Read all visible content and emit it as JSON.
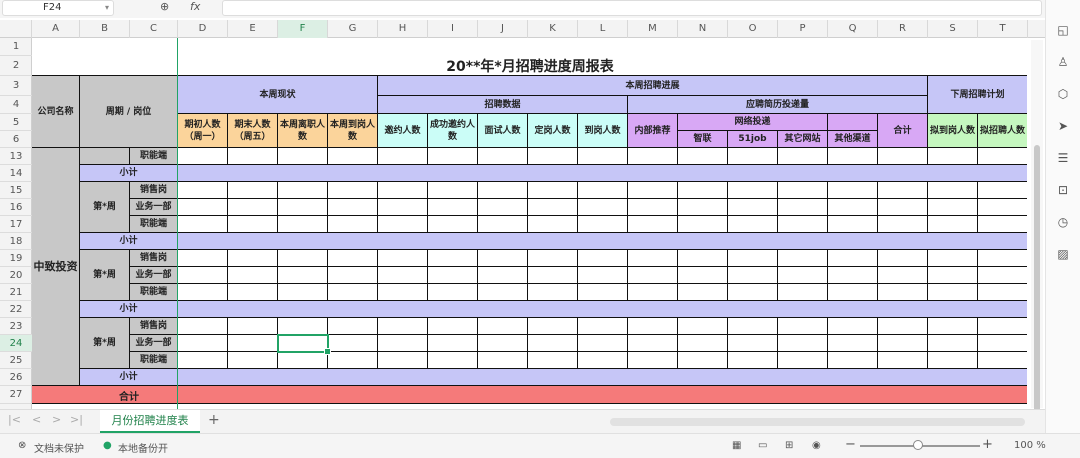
{
  "formula_bar": {
    "name_box": "F24",
    "zoom_icon": "zoom-formula-icon",
    "fx_label": "fx",
    "formula": ""
  },
  "columns": [
    "A",
    "B",
    "C",
    "D",
    "E",
    "F",
    "G",
    "H",
    "I",
    "J",
    "K",
    "L",
    "M",
    "N",
    "O",
    "P",
    "Q",
    "R",
    "S",
    "T"
  ],
  "rows": [
    "1",
    "2",
    "3",
    "4",
    "5",
    "6",
    "13",
    "14",
    "15",
    "16",
    "17",
    "18",
    "19",
    "20",
    "21",
    "22",
    "23",
    "24",
    "25",
    "26",
    "27"
  ],
  "selected": {
    "column": "F",
    "row": "24"
  },
  "sheet": {
    "title": "20**年*月招聘进度周报表",
    "company_header": "公司名称",
    "period_header": "周期 / 岗位",
    "current_status": "本周现状",
    "week_progress": "本周招聘进展",
    "next_week_plan": "下周招聘计划",
    "recruit_data": "招聘数据",
    "resume_volume": "应聘简历投递量",
    "online_delivery": "网络投递",
    "status_cols": [
      "期初人数（周一）",
      "期末人数（周五）",
      "本周离职人数",
      "本周到岗人数"
    ],
    "recruit_cols": [
      "邀约人数",
      "成功邀约人数",
      "面试人数",
      "定岗人数",
      "到岗人数"
    ],
    "internal": "内部推荐",
    "online_cols": [
      "智联",
      "51job",
      "其它网站"
    ],
    "other_channels": "其他渠道",
    "total_col": "合计",
    "plan_cols": [
      "拟到岗人数",
      "拟招聘人数"
    ],
    "company": "中致投资",
    "week_label": "第*周",
    "positions": [
      "职能端",
      "销售岗",
      "业务一部",
      "职能端"
    ],
    "subtotal": "小计",
    "grand_total": "合计"
  },
  "colors": {
    "purple": "#c6c6f7",
    "orange": "#fbd49b",
    "cyan": "#cbfdf7",
    "magenta": "#d8a8f5",
    "green": "#c5f7bf",
    "gray": "#c8c8c8",
    "red": "#f57a7a",
    "accent": "#21a366"
  },
  "tabs": {
    "prev_first": "|<",
    "prev": "<",
    "next": ">",
    "next_last": ">|",
    "active": "月份招聘进度表",
    "add": "+"
  },
  "status": {
    "protect": "文档未保护",
    "backup": "本地备份开",
    "zoom": "100 %",
    "minus": "−",
    "plus": "+"
  }
}
